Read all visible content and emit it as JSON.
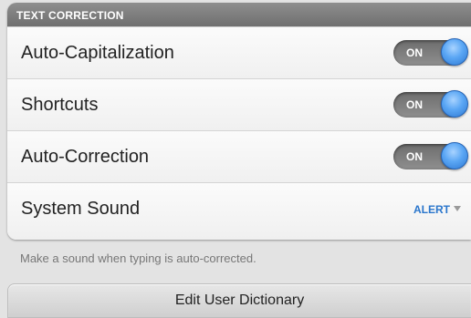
{
  "section": {
    "header": "TEXT CORRECTION",
    "rows": [
      {
        "label": "Auto-Capitalization",
        "toggle": "ON"
      },
      {
        "label": "Shortcuts",
        "toggle": "ON"
      },
      {
        "label": "Auto-Correction",
        "toggle": "ON"
      },
      {
        "label": "System Sound",
        "value": "ALERT"
      }
    ]
  },
  "hint": "Make a sound when typing is auto-corrected.",
  "edit_dictionary_button": "Edit User Dictionary",
  "colors": {
    "header_bg": "#7f7f7f",
    "toggle_knob": "#4a93e8",
    "dropdown_value": "#2a76cc"
  },
  "icons": {
    "dropdown": "chevron-down-icon"
  }
}
